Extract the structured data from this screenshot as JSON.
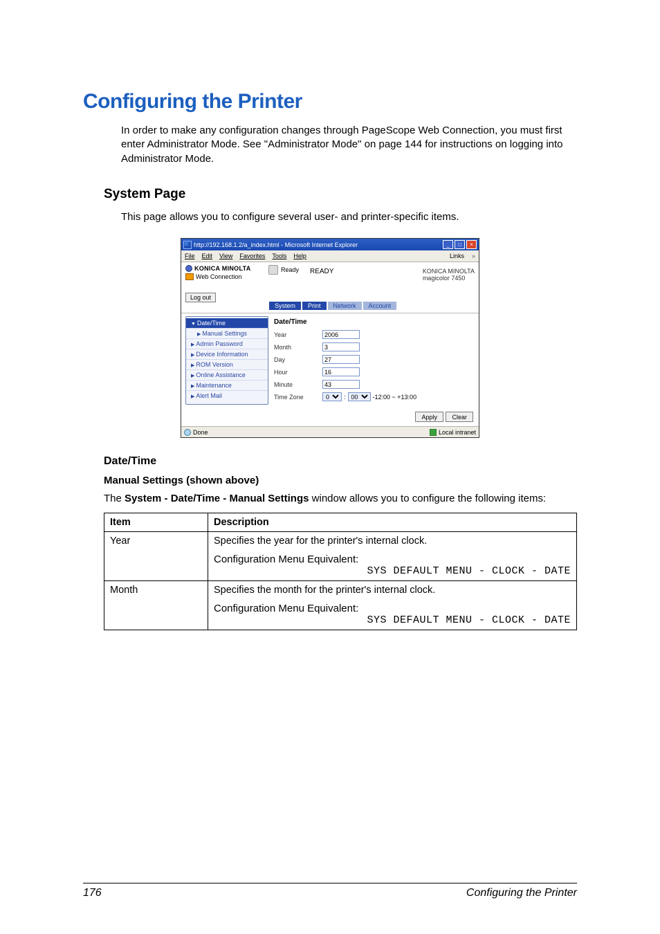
{
  "page": {
    "title_h1": "Configuring the Printer",
    "intro": "In order to make any configuration changes through PageScope Web Connection, you must first enter Administrator Mode. See \"Administrator Mode\" on page 144 for instructions on logging into Administrator Mode.",
    "h2": "System Page",
    "sys_intro": "This page allows you to configure several user- and printer-specific items."
  },
  "shot": {
    "window_title": "http://192.168.1.2/a_index.html - Microsoft Internet Explorer",
    "window_min": "_",
    "window_max": "□",
    "window_close": "×",
    "menu": {
      "file": "File",
      "edit": "Edit",
      "view": "View",
      "favorites": "Favorites",
      "tools": "Tools",
      "help": "Help",
      "links": "Links",
      "chev": "»"
    },
    "km_logo": "KONICA MINOLTA",
    "pgscope": "Web Connection",
    "log_out": "Log out",
    "ready_label": "Ready",
    "ready_big": "READY",
    "right_brand": "KONICA MINOLTA",
    "right_model": "magicolor 7450",
    "tabs": {
      "system": "System",
      "print": "Print",
      "network": "Network",
      "account": "Account"
    },
    "sidenav": {
      "date_time": "Date/Time",
      "manual": "Manual Settings",
      "admin_pw": "Admin Password",
      "dev_info": "Device Information",
      "rom": "ROM Version",
      "online": "Online Assistance",
      "maint": "Maintenance",
      "alert": "Alert Mail"
    },
    "content": {
      "heading": "Date/Time",
      "year_label": "Year",
      "year_val": "2006",
      "month_label": "Month",
      "month_val": "3",
      "day_label": "Day",
      "day_val": "27",
      "hour_label": "Hour",
      "hour_val": "16",
      "minute_label": "Minute",
      "minute_val": "43",
      "tz_label": "Time Zone",
      "tz_hr": "0",
      "tz_min": "00",
      "tz_range": "-12:00 ~ +13:00",
      "colon": ":"
    },
    "apply": "Apply",
    "clear": "Clear",
    "done": "Done",
    "intranet": "Local intranet"
  },
  "datetime": {
    "heading": "Date/Time",
    "manual_head": "Manual Settings (shown above)",
    "lead_pre": "The ",
    "lead_bold": "System - Date/Time - Manual Settings",
    "lead_post": " window allows you to configure the following items:"
  },
  "table": {
    "col_item": "Item",
    "col_desc": "Description",
    "row1_item": "Year",
    "row1_desc": "Specifies the year for the printer's internal clock.",
    "row1_cfg_label": "Configuration Menu Equivalent:",
    "row1_cfg_code": "SYS DEFAULT MENU - CLOCK - DATE",
    "row2_item": "Month",
    "row2_desc": "Specifies the month for the printer's internal clock.",
    "row2_cfg_label": "Configuration Menu Equivalent:",
    "row2_cfg_code": "SYS DEFAULT MENU - CLOCK - DATE"
  },
  "footer": {
    "page_num": "176",
    "right": "Configuring the Printer"
  }
}
